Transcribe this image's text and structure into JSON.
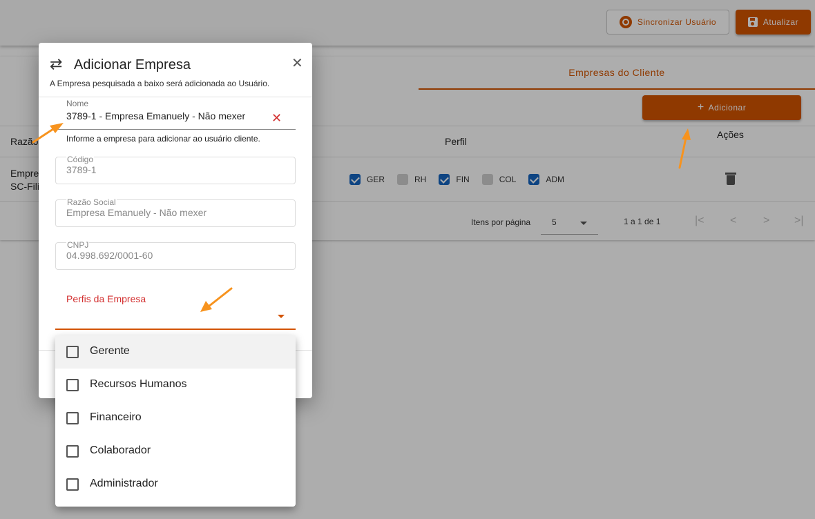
{
  "topbar": {
    "sync_label": "Sincronizar Usuário",
    "update_label": "Atualizar"
  },
  "card": {
    "tab_label": "Empresas do Cliente",
    "add_label": "Adicionar",
    "columns": {
      "razao": "Razão",
      "perfil": "Perfil",
      "acoes": "Ações"
    },
    "row": {
      "empresa_line1": "Empre",
      "empresa_line2": "SC-Fili",
      "perfis": [
        {
          "code": "GER",
          "checked": true
        },
        {
          "code": "RH",
          "checked": false
        },
        {
          "code": "FIN",
          "checked": true
        },
        {
          "code": "COL",
          "checked": false
        },
        {
          "code": "ADM",
          "checked": true
        }
      ]
    },
    "pager": {
      "label": "Itens por página",
      "page_size": "5",
      "range": "1 a 1 de 1"
    }
  },
  "dialog": {
    "title": "Adicionar Empresa",
    "subtitle": "A Empresa pesquisada a baixo será adicionada ao Usuário.",
    "nome_label": "Nome",
    "nome_value": "3789-1 - Empresa Emanuely - Não mexer",
    "nome_hint": "Informe a empresa para adicionar ao usuário cliente.",
    "codigo_label": "Código",
    "codigo_value": "3789-1",
    "razao_label": "Razão Social",
    "razao_value": "Empresa Emanuely - Não mexer",
    "cnpj_label": "CNPJ",
    "cnpj_value": "04.998.692/0001-60",
    "perfis_label": "Perfis da Empresa"
  },
  "dropdown": {
    "options": [
      "Gerente",
      "Recursos Humanos",
      "Financeiro",
      "Colaborador",
      "Administrador"
    ]
  },
  "colors": {
    "accent": "#d35400",
    "error": "#d32f2f",
    "checkbox": "#1565c0",
    "annotation": "#f7931e"
  }
}
